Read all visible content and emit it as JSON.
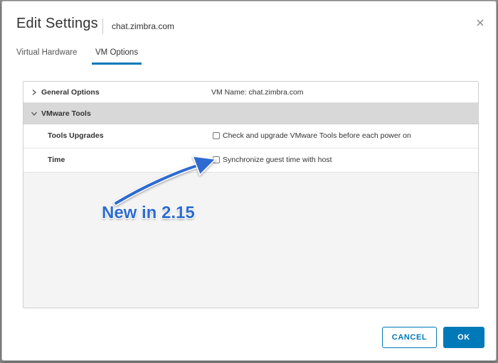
{
  "dialog": {
    "title": "Edit Settings",
    "subtitle": "chat.zimbra.com",
    "close_icon": "close-icon"
  },
  "tabs": [
    {
      "label": "Virtual Hardware",
      "active": false
    },
    {
      "label": "VM Options",
      "active": true
    }
  ],
  "sections": {
    "general_options": {
      "label": "General Options",
      "value": "VM Name: chat.zimbra.com",
      "icon": "chevron-right-icon",
      "expanded": false
    },
    "vmware_tools": {
      "label": "VMware Tools",
      "icon": "chevron-down-icon",
      "expanded": true,
      "rows": [
        {
          "label": "Tools Upgrades",
          "checkbox_label": "Check and upgrade VMware Tools before each power on",
          "checked": false
        },
        {
          "label": "Time",
          "checkbox_label": "Synchronize guest time with host",
          "checked": false
        }
      ]
    }
  },
  "annotation": {
    "text": "New in 2.15",
    "color": "#2d6bd0"
  },
  "buttons": {
    "cancel": "CANCEL",
    "ok": "OK"
  },
  "colors": {
    "accent": "#0079b8",
    "section_header_bg": "#d8d8d8"
  }
}
